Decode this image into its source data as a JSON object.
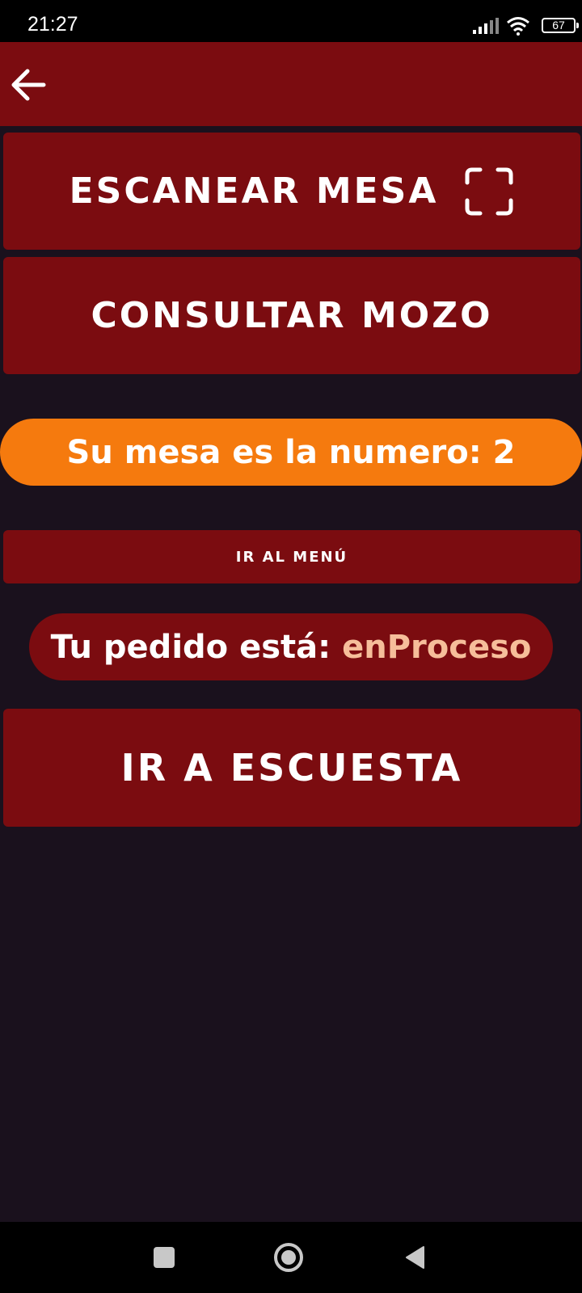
{
  "status_bar": {
    "time": "21:27",
    "battery": "67",
    "icons": [
      "signal-icon",
      "wifi-icon",
      "battery-icon"
    ]
  },
  "header": {
    "back_icon": "arrow-left-icon"
  },
  "buttons": {
    "scan_label": "ESCANEAR MESA",
    "scan_icon": "qr-scan-frame-icon",
    "mozo_label": "CONSULTAR MOZO",
    "menu_label": "IR AL MENÚ",
    "encuesta_label": "IR A ESCUESTA"
  },
  "mesa": {
    "text": "Su mesa es la numero: 2"
  },
  "pedido": {
    "label": "Tu pedido está:",
    "status": "enProceso"
  },
  "nav": {
    "icons": [
      "recents-icon",
      "home-icon",
      "back-icon"
    ]
  },
  "colors": {
    "background": "#1a111d",
    "primary": "#7b0c10",
    "accent": "#f57a0e",
    "status_highlight": "#f6be9a"
  }
}
